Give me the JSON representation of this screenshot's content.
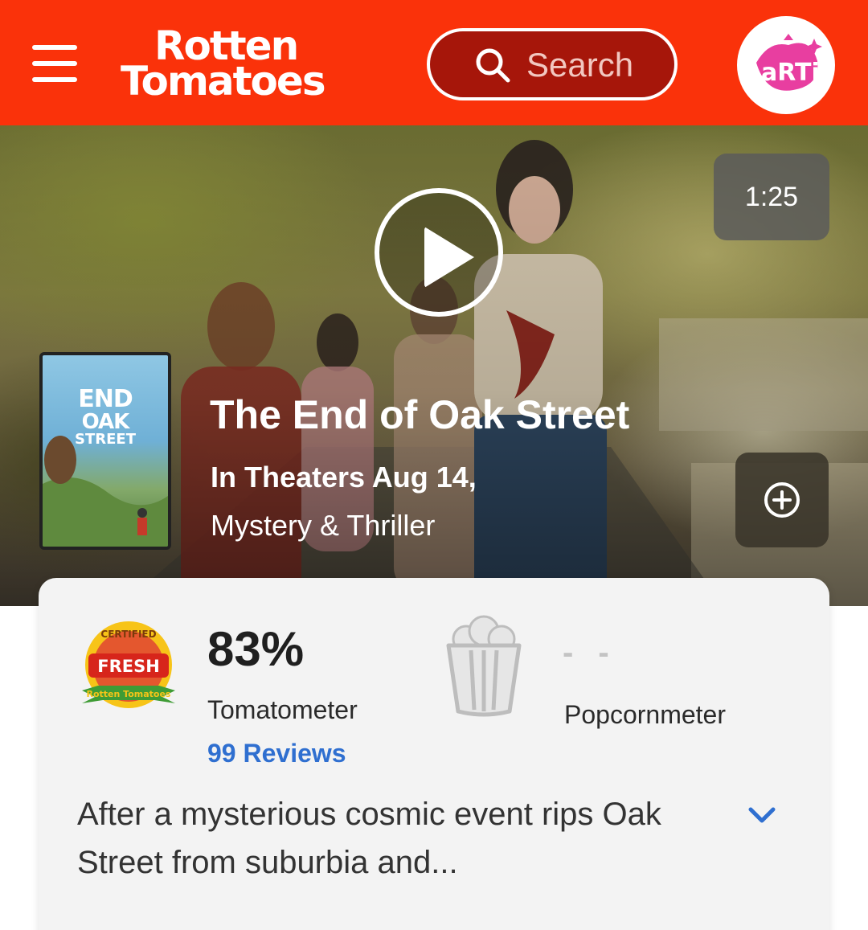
{
  "header": {
    "logo_line1": "Rotten",
    "logo_line2": "Tomatoes",
    "search_label": "Search",
    "avatar_label": "aRTi",
    "menu_icon": "hamburger-menu-icon",
    "search_icon": "search-icon"
  },
  "colors": {
    "brand_red": "#fa320a",
    "search_bg": "#a6160a",
    "link_blue": "#2f6fd0",
    "card_bg": "#f3f3f3"
  },
  "hero": {
    "video_duration": "1:25",
    "poster": {
      "line1": "END",
      "line2": "OAK",
      "line3": "STREET"
    },
    "title": "The End of Oak Street",
    "release": "In Theaters Aug 14,",
    "genre": "Mystery & Thriller",
    "play_icon": "play-icon",
    "add_icon": "plus-circle-icon"
  },
  "scores": {
    "tomatometer_badge": "CERTIFIED FRESH",
    "tomatometer_value": "83%",
    "tomatometer_label": "Tomatometer",
    "reviews_link": "99 Reviews",
    "popcornmeter_value": "- -",
    "popcornmeter_label": "Popcornmeter"
  },
  "synopsis": {
    "text": "After a mysterious cosmic event rips Oak Street from suburbia and...",
    "expand_icon": "chevron-down-icon"
  }
}
